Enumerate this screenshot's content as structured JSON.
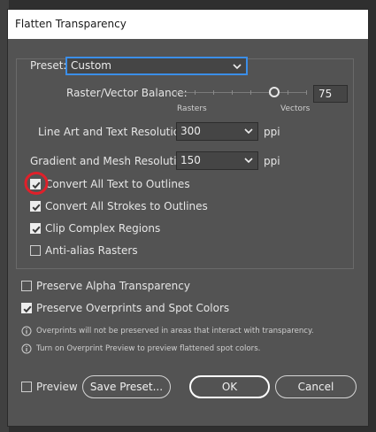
{
  "window": {
    "title": "Flatten Transparency"
  },
  "preset": {
    "label": "Preset:",
    "value": "Custom"
  },
  "balance": {
    "label": "Raster/Vector Balance:",
    "left_label": "Rasters",
    "right_label": "Vectors",
    "value": "75",
    "slider_fraction": 0.75
  },
  "line_art": {
    "label": "Line Art and Text Resolution:",
    "value": "300",
    "unit": "ppi"
  },
  "gradient": {
    "label": "Gradient and Mesh Resolution:",
    "value": "150",
    "unit": "ppi"
  },
  "options": [
    {
      "label": "Convert All Text to Outlines",
      "checked": true
    },
    {
      "label": "Convert All Strokes to Outlines",
      "checked": true
    },
    {
      "label": "Clip Complex Regions",
      "checked": true
    },
    {
      "label": "Anti-alias Rasters",
      "checked": false
    }
  ],
  "preserve_alpha": {
    "label": "Preserve Alpha Transparency",
    "checked": false
  },
  "preserve_overprints": {
    "label": "Preserve Overprints and Spot Colors",
    "checked": true
  },
  "notes": {
    "overprint_warning": "Overprints will not be preserved in areas that interact with transparency.",
    "overprint_preview": "Turn on Overprint Preview to preview flattened spot colors."
  },
  "footer": {
    "preview_label": "Preview",
    "preview_checked": false,
    "save_preset": "Save Preset...",
    "ok": "OK",
    "cancel": "Cancel"
  },
  "colors": {
    "focus": "#3b8ee8",
    "annotation": "#e0202a",
    "dialog_bg": "#535353"
  }
}
